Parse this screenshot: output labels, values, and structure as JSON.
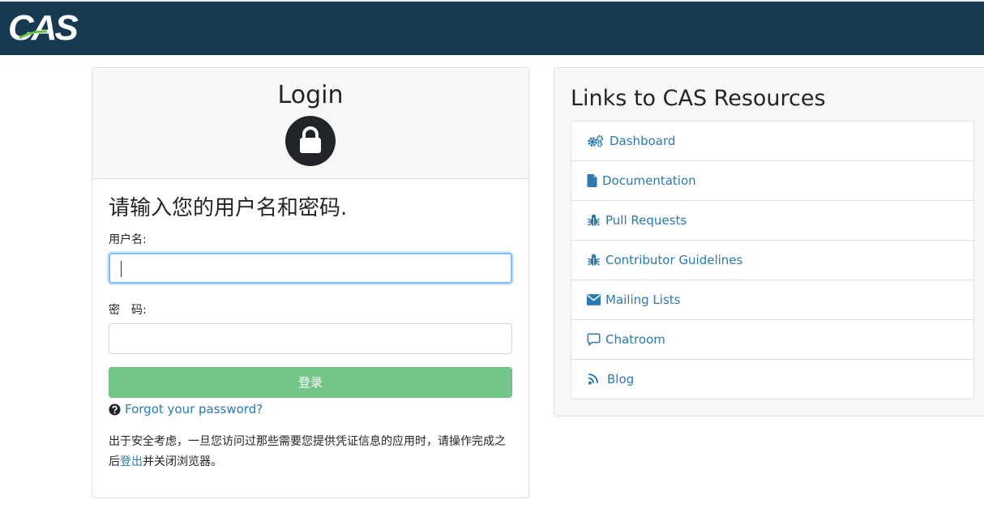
{
  "header": {
    "logo_text": "CAS"
  },
  "login": {
    "title": "Login",
    "prompt": "请输入您的用户名和密码.",
    "username_label": "用户名:",
    "password_label": "密　码:",
    "username_value": "",
    "password_value": "",
    "submit_label": "登录",
    "forgot_label": "Forgot your password?",
    "notice_before": "出于安全考虑，一旦您访问过那些需要您提供凭证信息的应用时，请操作完成之后",
    "notice_link": "登出",
    "notice_after": "并关闭浏览器。"
  },
  "resources": {
    "title": "Links to CAS Resources",
    "items": [
      {
        "label": "Dashboard",
        "icon": "gears-icon"
      },
      {
        "label": "Documentation",
        "icon": "file-icon"
      },
      {
        "label": "Pull Requests",
        "icon": "bug-icon"
      },
      {
        "label": "Contributor Guidelines",
        "icon": "bug-icon"
      },
      {
        "label": "Mailing Lists",
        "icon": "envelope-icon"
      },
      {
        "label": "Chatroom",
        "icon": "comment-icon"
      },
      {
        "label": "Blog",
        "icon": "rss-icon"
      }
    ]
  },
  "colors": {
    "header_bg": "#153a52",
    "link": "#2a7ab0",
    "submit_bg": "#73c687",
    "focus_border": "#80bdff"
  }
}
